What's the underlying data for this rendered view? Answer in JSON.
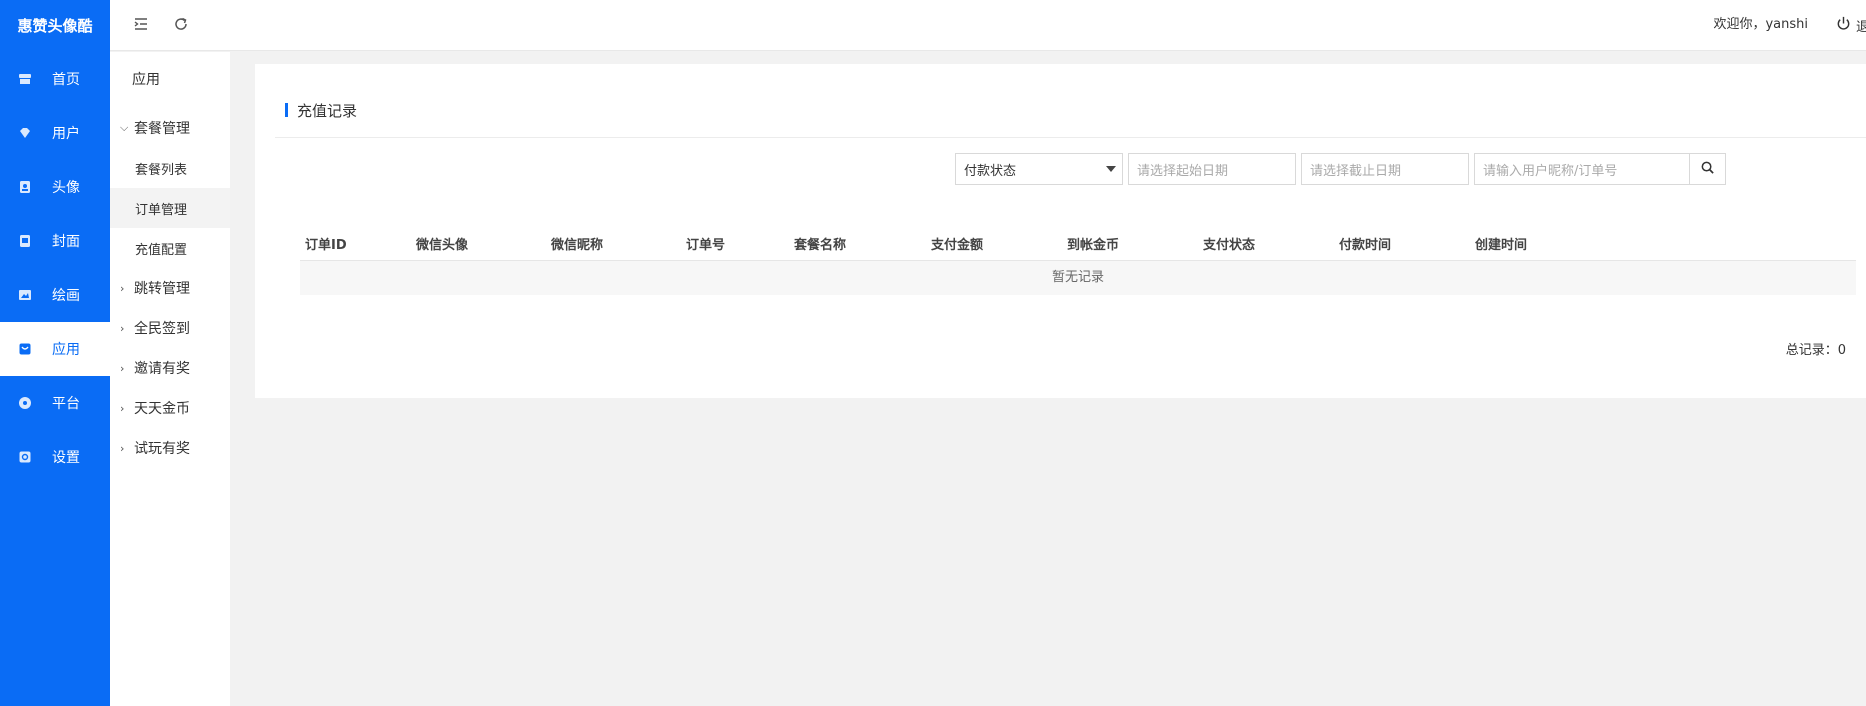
{
  "brand": "惠赞头像酷",
  "nav": [
    {
      "label": "首页",
      "icon": "store-icon"
    },
    {
      "label": "用户",
      "icon": "diamond-icon"
    },
    {
      "label": "头像",
      "icon": "portrait-icon"
    },
    {
      "label": "封面",
      "icon": "cover-icon"
    },
    {
      "label": "绘画",
      "icon": "picture-icon"
    },
    {
      "label": "应用",
      "icon": "app-icon"
    },
    {
      "label": "平台",
      "icon": "compass-icon"
    },
    {
      "label": "设置",
      "icon": "settings-icon"
    }
  ],
  "subnav": {
    "title": "应用",
    "group_open": "套餐管理",
    "items": [
      "套餐列表",
      "订单管理",
      "充值配置"
    ],
    "groups": [
      "跳转管理",
      "全民签到",
      "邀请有奖",
      "天天金币",
      "试玩有奖"
    ]
  },
  "header": {
    "welcome": "欢迎你，yanshi",
    "logout": "退出"
  },
  "page": {
    "title": "充值记录",
    "filters": {
      "status": "付款状态",
      "start_placeholder": "请选择起始日期",
      "end_placeholder": "请选择截止日期",
      "keyword_placeholder": "请输入用户昵称/订单号"
    },
    "columns": [
      "订单ID",
      "微信头像",
      "微信昵称",
      "订单号",
      "套餐名称",
      "支付金额",
      "到帐金币",
      "支付状态",
      "付款时间",
      "创建时间"
    ],
    "empty_text": "暂无记录",
    "total": "总记录：0"
  }
}
